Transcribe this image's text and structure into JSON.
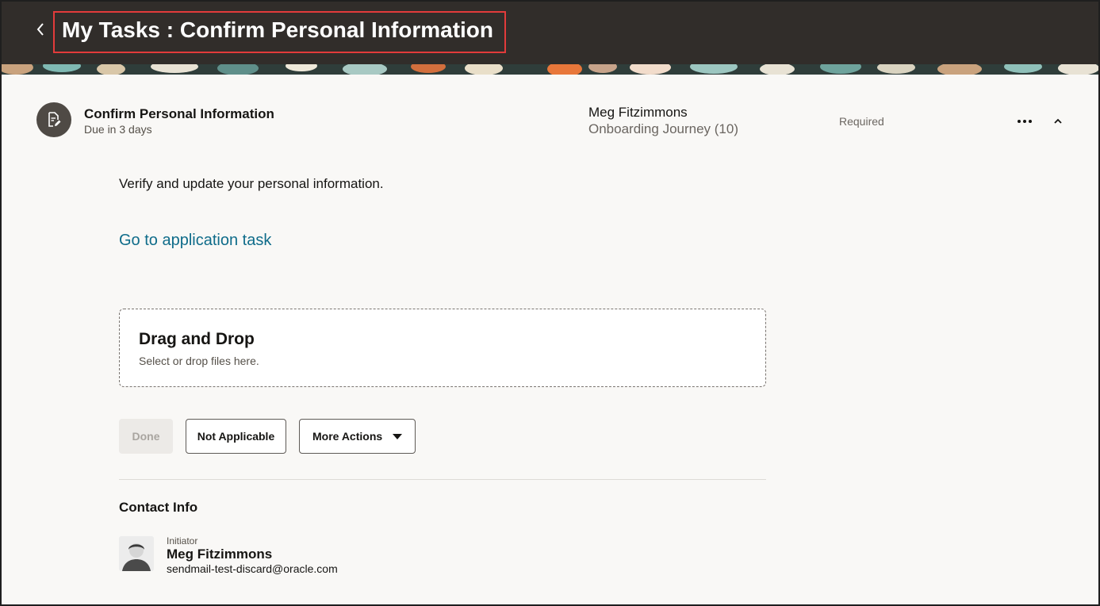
{
  "header": {
    "title": "My Tasks : Confirm Personal Information",
    "back_icon": "chevron-left-icon"
  },
  "task": {
    "icon": "document-edit-icon",
    "title": "Confirm Personal Information",
    "due": "Due in 3 days",
    "assignee": "Meg Fitzimmons",
    "journey": "Onboarding Journey (10)",
    "status": "Required",
    "more_icon": "ellipsis-icon",
    "collapse_icon": "chevron-up-icon",
    "description": "Verify and update your personal information.",
    "link_label": "Go to application task"
  },
  "dropzone": {
    "title": "Drag and Drop",
    "subtitle": "Select or drop files here."
  },
  "actions": {
    "done_label": "Done",
    "not_applicable_label": "Not Applicable",
    "more_actions_label": "More Actions"
  },
  "contact": {
    "heading": "Contact Info",
    "role": "Initiator",
    "name": "Meg Fitzimmons",
    "email": "sendmail-test-discard@oracle.com"
  },
  "colors": {
    "header_bg": "#312d2a",
    "highlight_border": "#e23b3b",
    "link": "#0f6c8a",
    "page_bg": "#f9f8f6"
  }
}
